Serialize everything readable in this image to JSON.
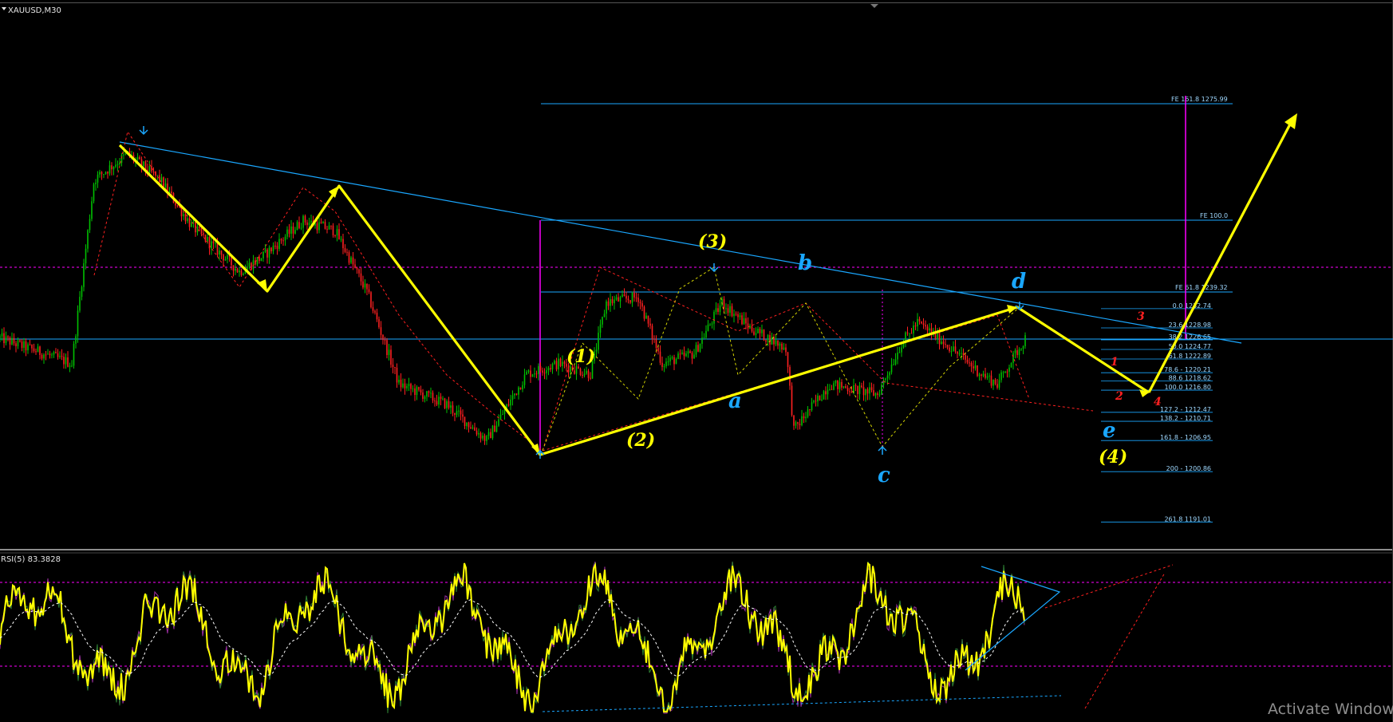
{
  "chart_title": "XAUUSD,M30",
  "rsi_title": "RSI(5) 83.3828",
  "watermark": "Activate Windows",
  "colors": {
    "bg": "#000000",
    "bull": "#00c000",
    "bear": "#ff2020",
    "wave": "#ffff00",
    "trend": "#1aa7ff",
    "fib": "#1aa7ff",
    "magenta": "#ff00ff",
    "rsi": "#ffff00"
  },
  "chart_data": [
    {
      "type": "candlestick",
      "symbol": "XAUUSD",
      "timeframe": "M30",
      "ylim": [
        1187,
        1290
      ],
      "price_path": [
        [
          0,
          1227
        ],
        [
          90,
          1222
        ],
        [
          118,
          1258
        ],
        [
          160,
          1263
        ],
        [
          200,
          1258
        ],
        [
          240,
          1249
        ],
        [
          300,
          1240
        ],
        [
          330,
          1243
        ],
        [
          380,
          1250
        ],
        [
          420,
          1248
        ],
        [
          460,
          1236
        ],
        [
          500,
          1218
        ],
        [
          560,
          1214
        ],
        [
          610,
          1207
        ],
        [
          660,
          1220
        ],
        [
          700,
          1222
        ],
        [
          740,
          1220
        ],
        [
          760,
          1234
        ],
        [
          800,
          1235
        ],
        [
          830,
          1222
        ],
        [
          870,
          1224
        ],
        [
          905,
          1234
        ],
        [
          940,
          1229
        ],
        [
          985,
          1225
        ],
        [
          995,
          1209
        ],
        [
          1040,
          1218
        ],
        [
          1100,
          1216
        ],
        [
          1130,
          1226
        ],
        [
          1150,
          1230
        ],
        [
          1185,
          1226
        ],
        [
          1230,
          1220
        ],
        [
          1250,
          1218
        ],
        [
          1285,
          1227
        ]
      ],
      "annotations": {
        "elliott_labels": [
          "(1)",
          "(2)",
          "(3)",
          "(4)"
        ],
        "abcde_labels": [
          "a",
          "b",
          "c",
          "d",
          "e"
        ],
        "subwave_labels": [
          "1",
          "2",
          "3",
          "4"
        ]
      },
      "fibonacci": {
        "expansion": [
          {
            "label": "FE 161.8 1275.99",
            "price": 1275.99
          },
          {
            "label": "FE 100.0",
            "price": 1252.0
          },
          {
            "label": "FE 61.8 1239.32",
            "price": 1239.32
          }
        ],
        "retracement": [
          {
            "label": "0.0 1232.74",
            "price": 1232.74
          },
          {
            "label": "23.6 1228.98",
            "price": 1228.98
          },
          {
            "label": "38.2 1226.65",
            "price": 1226.65
          },
          {
            "label": "50.0 1224.77",
            "price": 1224.77
          },
          {
            "label": "61.8 1222.89",
            "price": 1222.89
          },
          {
            "label": "78.6 - 1220.21",
            "price": 1220.21
          },
          {
            "label": "88.6 1218.62",
            "price": 1218.62
          },
          {
            "label": "100.0 1216.80",
            "price": 1216.8
          },
          {
            "label": "127.2 - 1212.47",
            "price": 1212.47
          },
          {
            "label": "138.2 - 1210.71",
            "price": 1210.71
          },
          {
            "label": "161.8 - 1206.95",
            "price": 1206.95
          },
          {
            "label": "200 - 1200.86",
            "price": 1200.86
          },
          {
            "label": "261.8 1191.01",
            "price": 1191.01
          }
        ]
      }
    },
    {
      "type": "line",
      "name": "RSI(5)",
      "last_value": 83.3828,
      "ylim": [
        0,
        100
      ],
      "levels": [
        70,
        30
      ]
    }
  ],
  "labels": {
    "w1": "(1)",
    "w2": "(2)",
    "w3": "(3)",
    "w4": "(4)",
    "a": "a",
    "b": "b",
    "c": "c",
    "d": "d",
    "e": "e",
    "s1": "1",
    "s2": "2",
    "s3": "3",
    "s4": "4"
  }
}
